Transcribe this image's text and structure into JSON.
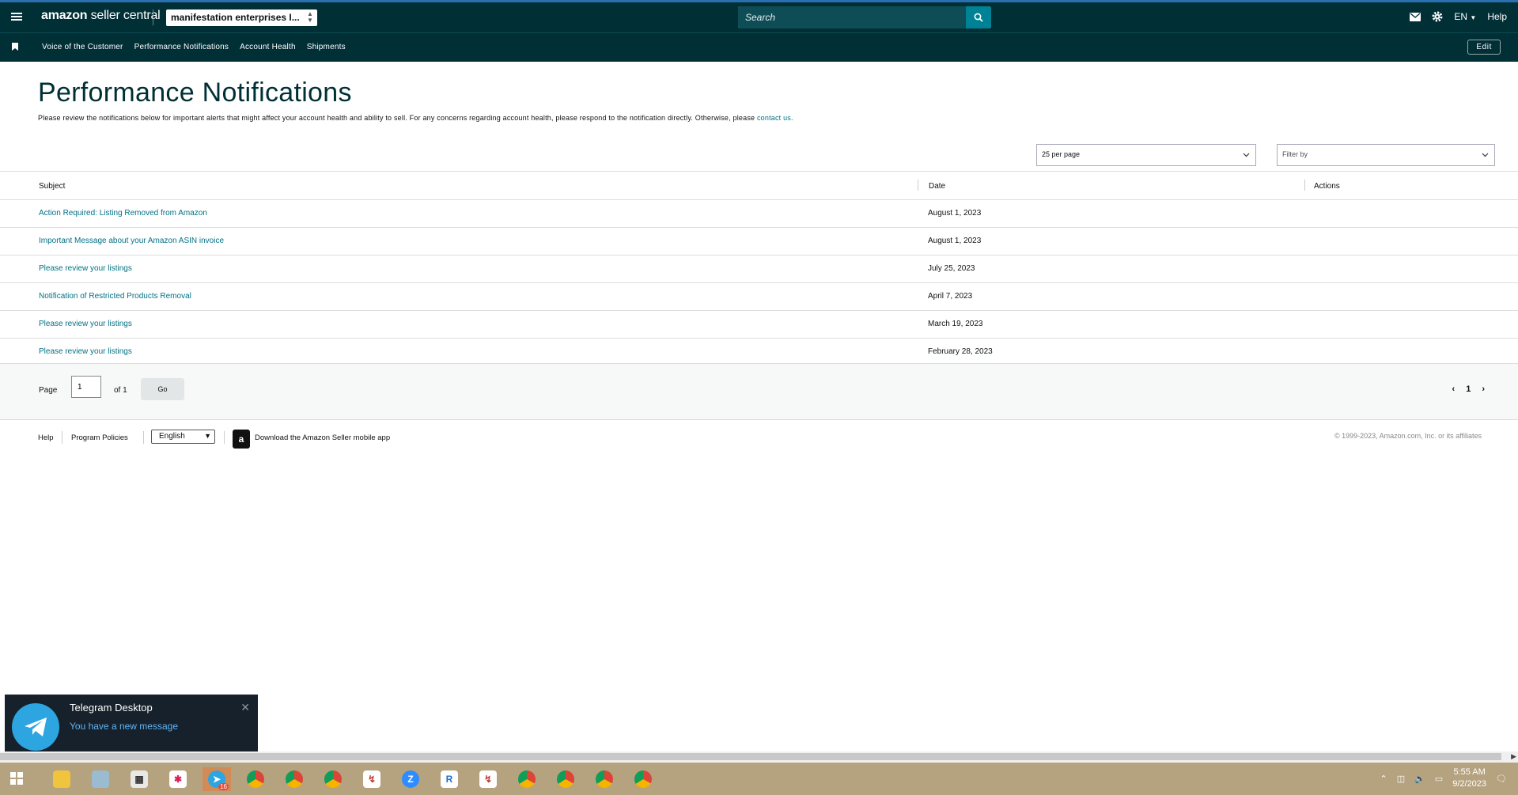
{
  "brand": {
    "logo_bold": "amazon",
    "logo_rest": " seller central",
    "store": "manifestation enterprises I..."
  },
  "search": {
    "placeholder": "Search"
  },
  "topright": {
    "lang": "EN",
    "help": "Help"
  },
  "subnav": {
    "items": [
      "Voice of the Customer",
      "Performance Notifications",
      "Account Health",
      "Shipments"
    ],
    "edit": "Edit"
  },
  "page": {
    "title": "Performance Notifications",
    "desc": "Please review the notifications below for important alerts that might affect your account health and ability to sell. For any concerns regarding account health, please respond to the notification directly. Otherwise, please ",
    "desc_link": "contact us."
  },
  "controls": {
    "per_page": "25 per page",
    "filter": "Filter by"
  },
  "table": {
    "headers": [
      "Subject",
      "Date",
      "Actions"
    ],
    "rows": [
      {
        "subject": "Action Required: Listing Removed from Amazon",
        "date": "August 1, 2023"
      },
      {
        "subject": "Important Message about your Amazon ASIN invoice",
        "date": "August 1, 2023"
      },
      {
        "subject": "Please review your listings",
        "date": "July 25, 2023"
      },
      {
        "subject": "Notification of Restricted Products Removal",
        "date": "April 7, 2023"
      },
      {
        "subject": "Please review your listings",
        "date": "March 19, 2023"
      },
      {
        "subject": "Please review your listings",
        "date": "February 28, 2023"
      }
    ]
  },
  "pager": {
    "page_label": "Page",
    "page_value": "1",
    "of": "of 1",
    "go": "Go",
    "current": "1"
  },
  "footer": {
    "help": "Help",
    "policies": "Program Policies",
    "lang": "English",
    "app": "Download the Amazon Seller mobile app",
    "copyright": "© 1999-2023, Amazon.com, Inc. or its affiliates"
  },
  "toast": {
    "title": "Telegram Desktop",
    "message": "You have a new message"
  },
  "taskbar": {
    "time": "5:55 AM",
    "date": "9/2/2023",
    "telegram_badge": "16"
  },
  "colors": {
    "header": "#002f36",
    "link": "#007185",
    "search_btn": "#008296",
    "taskbar": "#b5a27f"
  }
}
